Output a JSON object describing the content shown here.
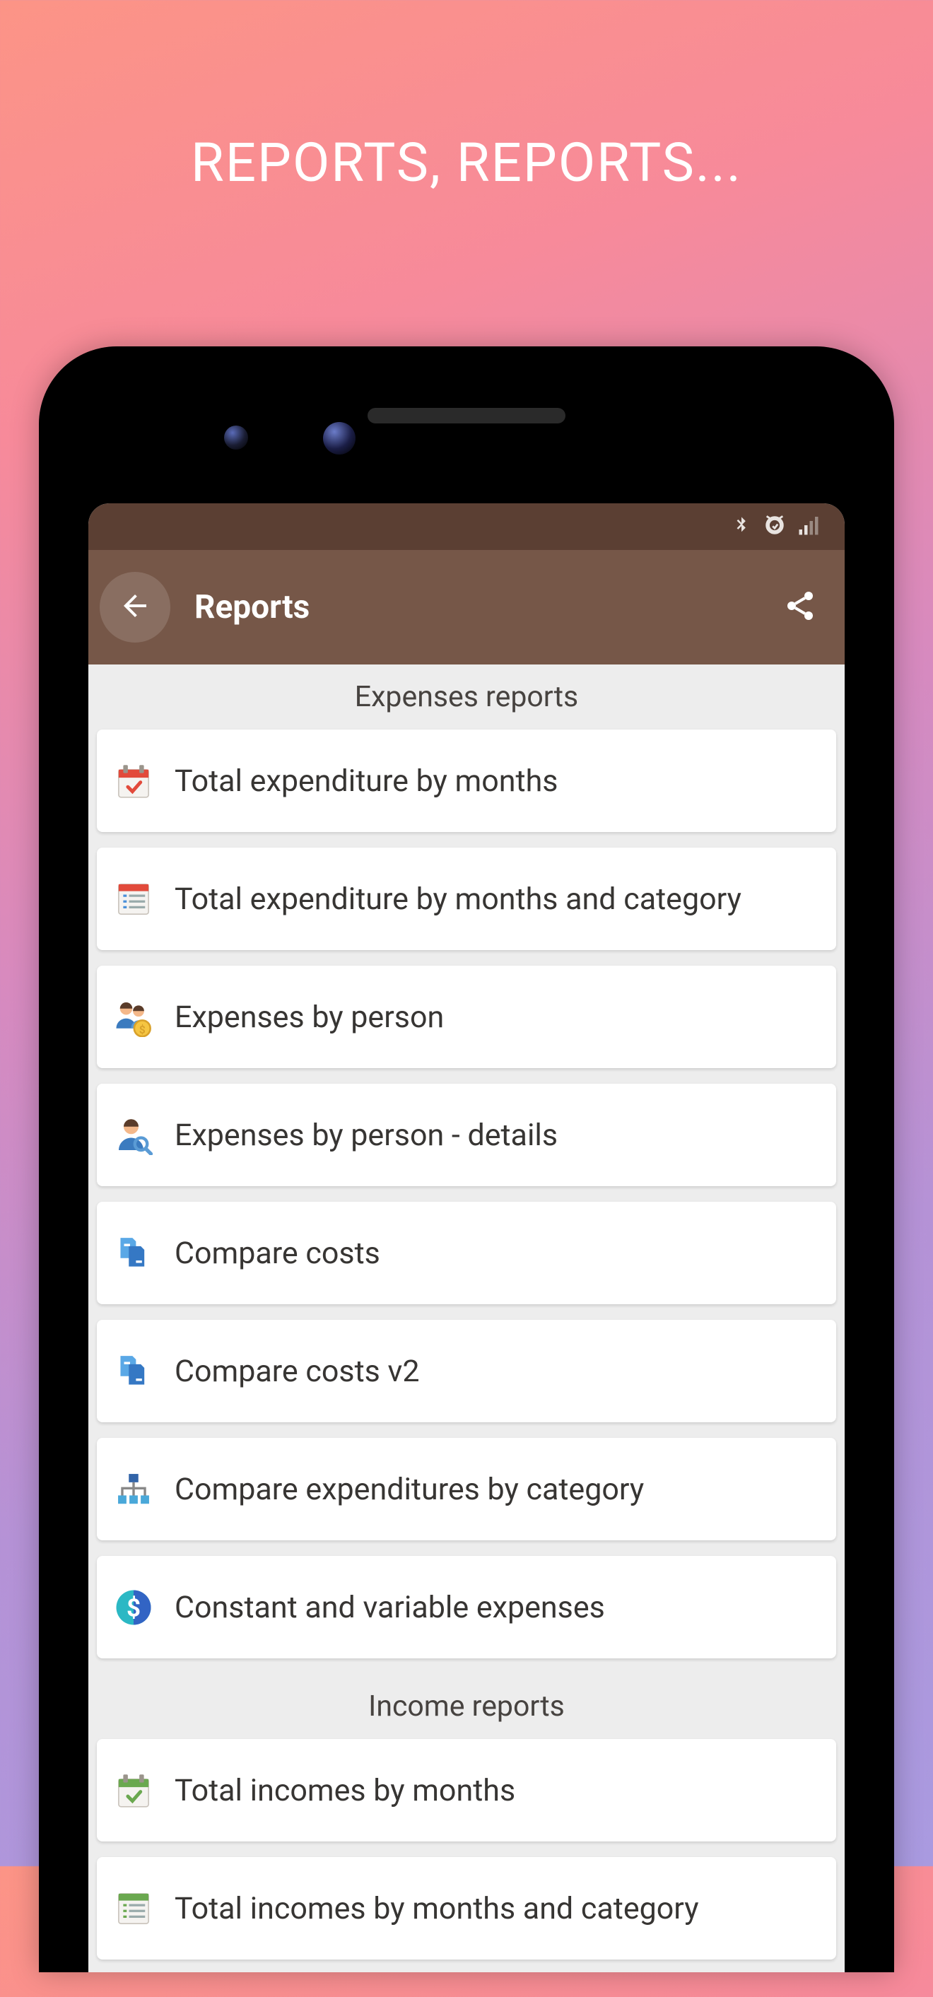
{
  "page_heading": "REPORTS, REPORTS...",
  "appbar": {
    "title": "Reports"
  },
  "sections": [
    {
      "title": "Expenses reports",
      "items": [
        {
          "icon": "calendar-check-red",
          "label": "Total expenditure by months"
        },
        {
          "icon": "list-notebook",
          "label": "Total expenditure by months and category"
        },
        {
          "icon": "people-coin",
          "label": "Expenses by person"
        },
        {
          "icon": "person-search",
          "label": "Expenses by person - details"
        },
        {
          "icon": "compare-files",
          "label": "Compare costs"
        },
        {
          "icon": "compare-files",
          "label": "Compare costs v2"
        },
        {
          "icon": "hierarchy",
          "label": "Compare expenditures by category"
        },
        {
          "icon": "dollar-circle",
          "label": "Constant and variable expenses"
        }
      ]
    },
    {
      "title": "Income reports",
      "items": [
        {
          "icon": "calendar-check-green",
          "label": "Total incomes by months"
        },
        {
          "icon": "list-green",
          "label": "Total incomes by months and category"
        }
      ]
    }
  ]
}
